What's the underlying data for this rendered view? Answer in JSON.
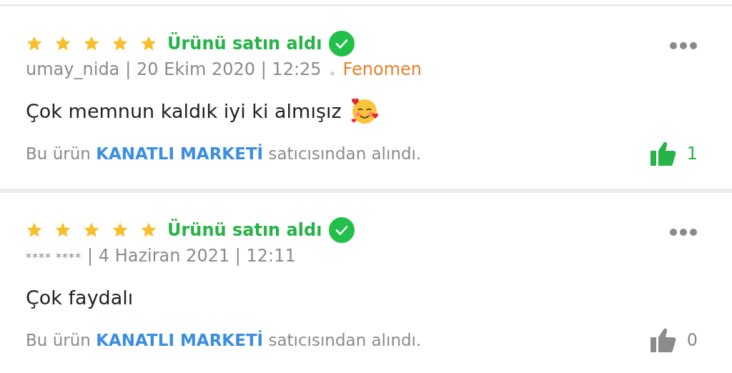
{
  "reviews": [
    {
      "stars": 5,
      "verified": true,
      "verified_label": "Ürünü satın aldı",
      "author": "umay_nida",
      "author_masked": false,
      "posted": "| 20 Ekim 2020 | 12:25",
      "badge": "Fenomen",
      "comment": "Çok memnun kaldık iyi ki almışız",
      "has_emoji": true,
      "seller_prefix": "Bu ürün",
      "seller": "KANATLI MARKETİ",
      "seller_suffix": "satıcısından alındı.",
      "likes": "1",
      "liked": true
    },
    {
      "stars": 5,
      "verified": true,
      "verified_label": "Ürünü satın aldı",
      "author": "**** ****",
      "author_masked": true,
      "posted": "| 4 Haziran 2021 | 12:11",
      "comment": "Çok faydalı",
      "has_emoji": false,
      "seller_prefix": "Bu ürün",
      "seller": "KANATLI MARKETİ",
      "seller_suffix": "satıcısından alındı.",
      "likes": "0",
      "liked": false
    }
  ]
}
